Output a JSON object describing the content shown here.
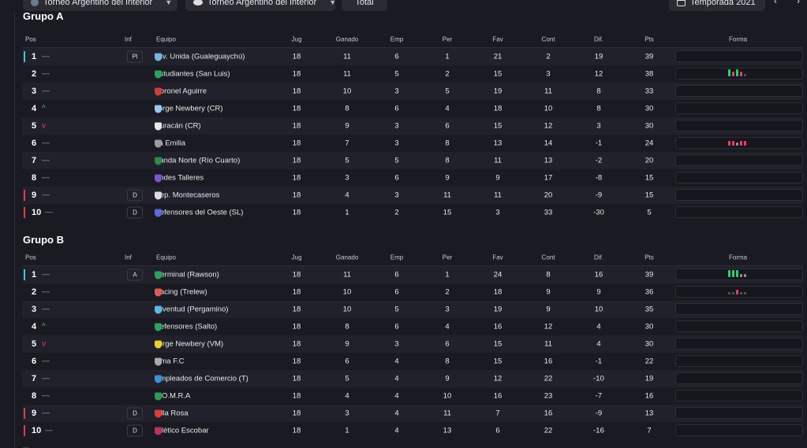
{
  "topbar": {
    "tournament_select_1": "Torneo Argentino del Interior",
    "tournament_select_2": "Torneo Argentino del Interior",
    "view_select": "Total",
    "season_select": "Temporada 2021"
  },
  "columns": {
    "pos": "Pos",
    "inf": "Inf",
    "team": "Equipo",
    "jug": "Jug",
    "gan": "Ganado",
    "emp": "Emp",
    "per": "Per",
    "fav": "Fav",
    "con": "Cont",
    "dif": "Dif.",
    "pts": "Pts",
    "forma": "Forma"
  },
  "groups": [
    {
      "title": "Grupo A",
      "rows": [
        {
          "pos": "1",
          "trend": "—",
          "trend_dir": "same",
          "inf": "Pl",
          "team": "Juv. Unida (Gualeguaychú)",
          "crest": "#6fb7e0",
          "jug": "18",
          "gan": "11",
          "emp": "6",
          "per": "1",
          "fav": "21",
          "con": "2",
          "dif": "19",
          "pts": "39",
          "marker": "champ",
          "form": []
        },
        {
          "pos": "2",
          "trend": "—",
          "trend_dir": "same",
          "inf": "",
          "team": "Estudiantes (San Luis)",
          "crest": "#29a45a",
          "jug": "18",
          "gan": "11",
          "emp": "5",
          "per": "2",
          "fav": "15",
          "con": "3",
          "dif": "12",
          "pts": "38",
          "marker": "",
          "form": [
            "w",
            "l",
            "w",
            "l",
            "n"
          ]
        },
        {
          "pos": "3",
          "trend": "—",
          "trend_dir": "same",
          "inf": "",
          "team": "Coronel Aguirre",
          "crest": "#d23b3b",
          "jug": "18",
          "gan": "10",
          "emp": "3",
          "per": "5",
          "fav": "19",
          "con": "11",
          "dif": "8",
          "pts": "33",
          "marker": "",
          "form": []
        },
        {
          "pos": "4",
          "trend": "^",
          "trend_dir": "up",
          "inf": "",
          "team": "Jorge Newbery (CR)",
          "crest": "#9ac8ee",
          "jug": "18",
          "gan": "8",
          "emp": "6",
          "per": "4",
          "fav": "18",
          "con": "10",
          "dif": "8",
          "pts": "30",
          "marker": "",
          "form": []
        },
        {
          "pos": "5",
          "trend": "v",
          "trend_dir": "down",
          "inf": "",
          "team": "Huracán (CR)",
          "crest": "#e8e8e8",
          "jug": "18",
          "gan": "9",
          "emp": "3",
          "per": "6",
          "fav": "15",
          "con": "12",
          "dif": "3",
          "pts": "30",
          "marker": "",
          "form": []
        },
        {
          "pos": "6",
          "trend": "—",
          "trend_dir": "same",
          "inf": "",
          "team": "La Emilia",
          "crest": "#9a9aa2",
          "jug": "18",
          "gan": "7",
          "emp": "3",
          "per": "8",
          "fav": "13",
          "con": "14",
          "dif": "-1",
          "pts": "24",
          "marker": "",
          "form": [
            "l",
            "l",
            "d",
            "l",
            "l"
          ]
        },
        {
          "pos": "7",
          "trend": "—",
          "trend_dir": "same",
          "inf": "",
          "team": "Banda Norte (Río Cuarto)",
          "crest": "#2e8a4c",
          "jug": "18",
          "gan": "5",
          "emp": "5",
          "per": "8",
          "fav": "11",
          "con": "13",
          "dif": "-2",
          "pts": "20",
          "marker": "",
          "form": []
        },
        {
          "pos": "8",
          "trend": "—",
          "trend_dir": "same",
          "inf": "",
          "team": "Andes Talleres",
          "crest": "#7a56c9",
          "jug": "18",
          "gan": "3",
          "emp": "6",
          "per": "9",
          "fav": "9",
          "con": "17",
          "dif": "-8",
          "pts": "15",
          "marker": "",
          "form": []
        },
        {
          "pos": "9",
          "trend": "—",
          "trend_dir": "same",
          "inf": "D",
          "team": "Dep. Montecaseros",
          "crest": "#dcdcdc",
          "jug": "18",
          "gan": "4",
          "emp": "3",
          "per": "11",
          "fav": "11",
          "con": "20",
          "dif": "-9",
          "pts": "15",
          "marker": "rel",
          "form": []
        },
        {
          "pos": "10",
          "trend": "—",
          "trend_dir": "same",
          "inf": "D",
          "team": "Defensores del Oeste (SL)",
          "crest": "#5a6bd8",
          "jug": "18",
          "gan": "1",
          "emp": "2",
          "per": "15",
          "fav": "3",
          "con": "33",
          "dif": "-30",
          "pts": "5",
          "marker": "rel",
          "form": []
        }
      ]
    },
    {
      "title": "Grupo B",
      "rows": [
        {
          "pos": "1",
          "trend": "—",
          "trend_dir": "same",
          "inf": "A",
          "team": "Germinal (Rawson)",
          "crest": "#2aa35a",
          "jug": "18",
          "gan": "11",
          "emp": "6",
          "per": "1",
          "fav": "24",
          "con": "8",
          "dif": "16",
          "pts": "39",
          "marker": "champ",
          "form": [
            "w",
            "w",
            "w",
            "d",
            "d"
          ]
        },
        {
          "pos": "2",
          "trend": "—",
          "trend_dir": "same",
          "inf": "",
          "team": "Racing (Trelew)",
          "crest": "#e05a5a",
          "jug": "18",
          "gan": "10",
          "emp": "6",
          "per": "2",
          "fav": "18",
          "con": "9",
          "dif": "9",
          "pts": "36",
          "marker": "",
          "form": [
            "n",
            "n",
            "l",
            "n",
            "n"
          ]
        },
        {
          "pos": "3",
          "trend": "—",
          "trend_dir": "same",
          "inf": "",
          "team": "Juventud (Pergamino)",
          "crest": "#5ab8e8",
          "jug": "18",
          "gan": "10",
          "emp": "5",
          "per": "3",
          "fav": "19",
          "con": "9",
          "dif": "10",
          "pts": "35",
          "marker": "",
          "form": []
        },
        {
          "pos": "4",
          "trend": "^",
          "trend_dir": "up",
          "inf": "",
          "team": "Defensores (Salto)",
          "crest": "#2aa35a",
          "jug": "18",
          "gan": "8",
          "emp": "6",
          "per": "4",
          "fav": "16",
          "con": "12",
          "dif": "4",
          "pts": "30",
          "marker": "",
          "form": []
        },
        {
          "pos": "5",
          "trend": "v",
          "trend_dir": "down",
          "inf": "",
          "team": "Jorge Newbery (VM)",
          "crest": "#e8d22a",
          "jug": "18",
          "gan": "9",
          "emp": "3",
          "per": "6",
          "fav": "15",
          "con": "11",
          "dif": "4",
          "pts": "30",
          "marker": "",
          "form": []
        },
        {
          "pos": "6",
          "trend": "—",
          "trend_dir": "same",
          "inf": "",
          "team": "Lima F.C",
          "crest": "#aaaaaa",
          "jug": "18",
          "gan": "6",
          "emp": "4",
          "per": "8",
          "fav": "15",
          "con": "16",
          "dif": "-1",
          "pts": "22",
          "marker": "",
          "form": []
        },
        {
          "pos": "7",
          "trend": "—",
          "trend_dir": "same",
          "inf": "",
          "team": "Empleados de Comercio (T)",
          "crest": "#3d8fd8",
          "jug": "18",
          "gan": "5",
          "emp": "4",
          "per": "9",
          "fav": "12",
          "con": "22",
          "dif": "-10",
          "pts": "19",
          "marker": "",
          "form": []
        },
        {
          "pos": "8",
          "trend": "—",
          "trend_dir": "same",
          "inf": "",
          "team": "S.O.M.R.A",
          "crest": "#2e9a5a",
          "jug": "18",
          "gan": "4",
          "emp": "4",
          "per": "10",
          "fav": "16",
          "con": "23",
          "dif": "-7",
          "pts": "16",
          "marker": "",
          "form": []
        },
        {
          "pos": "9",
          "trend": "—",
          "trend_dir": "same",
          "inf": "D",
          "team": "Villa Rosa",
          "crest": "#e03a3a",
          "jug": "18",
          "gan": "3",
          "emp": "4",
          "per": "11",
          "fav": "7",
          "con": "16",
          "dif": "-9",
          "pts": "13",
          "marker": "rel",
          "form": []
        },
        {
          "pos": "10",
          "trend": "—",
          "trend_dir": "same",
          "inf": "D",
          "team": "Atlético Escobar",
          "crest": "#c0305a",
          "jug": "18",
          "gan": "1",
          "emp": "4",
          "per": "13",
          "fav": "6",
          "con": "22",
          "dif": "-16",
          "pts": "7",
          "marker": "rel",
          "form": []
        }
      ]
    }
  ]
}
